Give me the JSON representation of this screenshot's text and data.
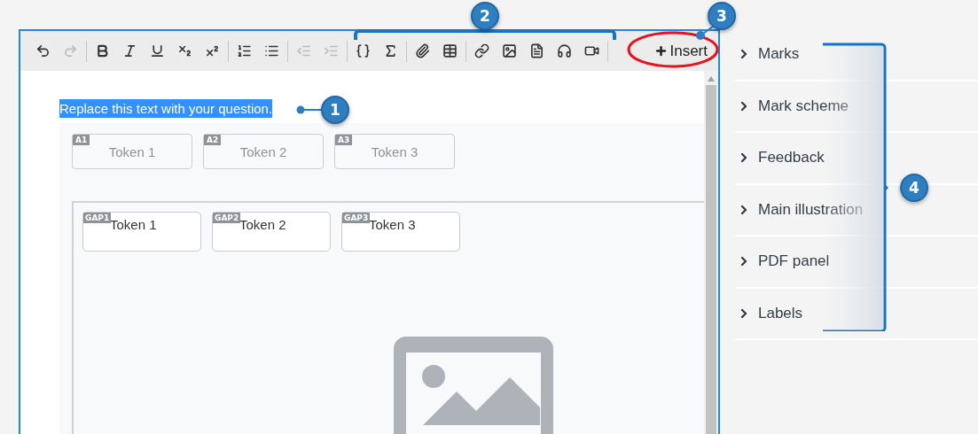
{
  "toolbar": [
    {
      "kind": "undo",
      "disabled": false
    },
    {
      "kind": "redo",
      "disabled": true
    },
    {
      "kind": "separator"
    },
    {
      "kind": "bold",
      "disabled": false
    },
    {
      "kind": "italic",
      "disabled": false
    },
    {
      "kind": "underline",
      "disabled": false
    },
    {
      "kind": "subscript",
      "disabled": false
    },
    {
      "kind": "superscript",
      "disabled": false
    },
    {
      "kind": "separator"
    },
    {
      "kind": "ordered-list",
      "disabled": false
    },
    {
      "kind": "bullet-list",
      "disabled": false
    },
    {
      "kind": "separator"
    },
    {
      "kind": "outdent",
      "disabled": true
    },
    {
      "kind": "indent",
      "disabled": true
    },
    {
      "kind": "separator"
    },
    {
      "kind": "braces",
      "disabled": false
    },
    {
      "kind": "sigma",
      "disabled": false
    },
    {
      "kind": "separator"
    },
    {
      "kind": "attachment",
      "disabled": false
    },
    {
      "kind": "table",
      "disabled": false
    },
    {
      "kind": "separator"
    },
    {
      "kind": "link",
      "disabled": false
    },
    {
      "kind": "image",
      "disabled": false
    },
    {
      "kind": "pdf",
      "disabled": false
    },
    {
      "kind": "audio",
      "disabled": false
    },
    {
      "kind": "video",
      "disabled": false
    },
    {
      "kind": "separator"
    }
  ],
  "insert_button": {
    "label": "Insert"
  },
  "question": {
    "text": "Replace this text with your question.",
    "selected": true
  },
  "tokens": [
    {
      "tag": "A1",
      "label": "Token 1"
    },
    {
      "tag": "A2",
      "label": "Token 2"
    },
    {
      "tag": "A3",
      "label": "Token 3"
    }
  ],
  "gaps": [
    {
      "tag": "GAP1",
      "label": "Token 1"
    },
    {
      "tag": "GAP2",
      "label": "Token 2"
    },
    {
      "tag": "GAP3",
      "label": "Token 3"
    }
  ],
  "sidebar": {
    "items": [
      {
        "label": "Marks",
        "expanded": false
      },
      {
        "label": "Mark scheme",
        "expanded": false
      },
      {
        "label": "Feedback",
        "expanded": false
      },
      {
        "label": "Main illustration",
        "expanded": false
      },
      {
        "label": "PDF panel",
        "expanded": false
      },
      {
        "label": "Labels",
        "expanded": false
      }
    ]
  },
  "callouts": [
    "1",
    "2",
    "3",
    "4"
  ]
}
